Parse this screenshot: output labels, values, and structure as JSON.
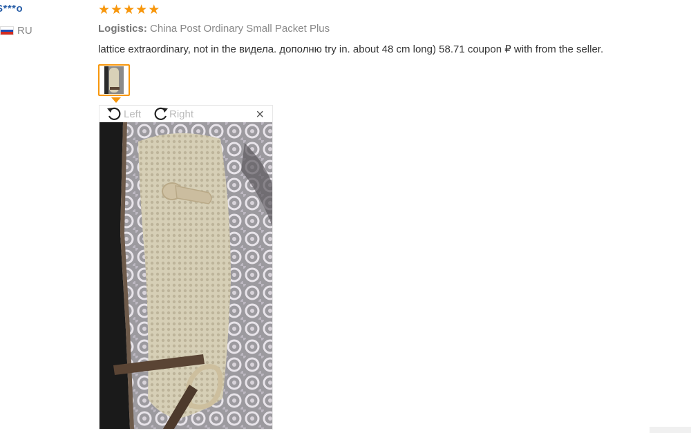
{
  "buyer": {
    "name": "S***o",
    "country": "RU"
  },
  "review": {
    "rating": 5,
    "stars": [
      "★",
      "★",
      "★",
      "★",
      "★"
    ],
    "logistics_label": "Logistics:",
    "logistics_value": "China Post Ordinary Small Packet Plus",
    "feedback_text": "lattice extraordinary, not in the видела. дополню try in. about 48 cm long) 58.71 coupon ₽ with from the seller."
  },
  "viewer": {
    "rotate_left_label": "Left",
    "rotate_right_label": "Right",
    "close_label": "×"
  },
  "colors": {
    "star": "#f7960b",
    "name": "#2a5fa8",
    "thumb_border": "#f7960b"
  },
  "icons": {
    "rotate_left": "rotate-left-icon",
    "rotate_right": "rotate-right-icon",
    "close": "close-icon",
    "flag": "russia-flag-icon"
  }
}
